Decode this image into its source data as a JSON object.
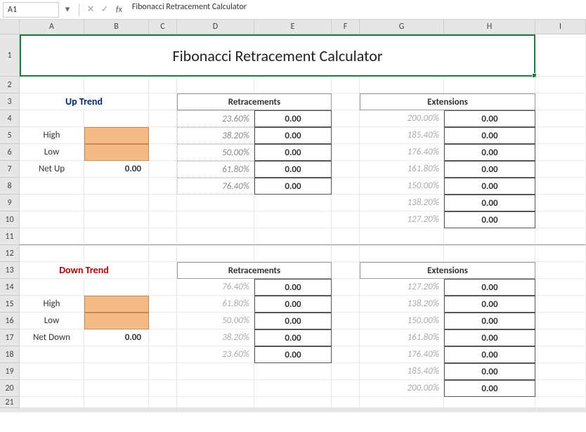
{
  "namebox": "A1",
  "fx_label": "fx",
  "formula": "Fibonacci Retracement Calculator",
  "columns": [
    "",
    "A",
    "B",
    "C",
    "D",
    "E",
    "F",
    "G",
    "H",
    "I"
  ],
  "title": "Fibonacci Retracement Calculator",
  "up": {
    "heading": "Up Trend",
    "labels": {
      "high": "High",
      "low": "Low",
      "net": "Net Up",
      "net_val": "0.00"
    },
    "retr_hdr": "Retracements",
    "ext_hdr": "Extensions",
    "retr": [
      {
        "pct": "23.60%",
        "val": "0.00"
      },
      {
        "pct": "38.20%",
        "val": "0.00"
      },
      {
        "pct": "50.00%",
        "val": "0.00"
      },
      {
        "pct": "61.80%",
        "val": "0.00"
      },
      {
        "pct": "76.40%",
        "val": "0.00"
      }
    ],
    "ext": [
      {
        "pct": "200.00%",
        "val": "0.00"
      },
      {
        "pct": "185.40%",
        "val": "0.00"
      },
      {
        "pct": "176.40%",
        "val": "0.00"
      },
      {
        "pct": "161.80%",
        "val": "0.00"
      },
      {
        "pct": "150.00%",
        "val": "0.00"
      },
      {
        "pct": "138.20%",
        "val": "0.00"
      },
      {
        "pct": "127.20%",
        "val": "0.00"
      }
    ]
  },
  "down": {
    "heading": "Down Trend",
    "labels": {
      "high": "High",
      "low": "Low",
      "net": "Net Down",
      "net_val": "0.00"
    },
    "retr_hdr": "Retracements",
    "ext_hdr": "Extensions",
    "retr": [
      {
        "pct": "76.40%",
        "val": "0.00"
      },
      {
        "pct": "61.80%",
        "val": "0.00"
      },
      {
        "pct": "50.00%",
        "val": "0.00"
      },
      {
        "pct": "38.20%",
        "val": "0.00"
      },
      {
        "pct": "23.60%",
        "val": "0.00"
      }
    ],
    "ext": [
      {
        "pct": "127.20%",
        "val": "0.00"
      },
      {
        "pct": "138.20%",
        "val": "0.00"
      },
      {
        "pct": "150.00%",
        "val": "0.00"
      },
      {
        "pct": "161.80%",
        "val": "0.00"
      },
      {
        "pct": "176.40%",
        "val": "0.00"
      },
      {
        "pct": "185.40%",
        "val": "0.00"
      },
      {
        "pct": "200.00%",
        "val": "0.00"
      }
    ]
  },
  "chart_data": {
    "type": "table",
    "title": "Fibonacci Retracement Calculator",
    "sections": [
      {
        "name": "Up Trend",
        "inputs": {
          "high": null,
          "low": null,
          "net_up": 0.0
        },
        "retracements": [
          {
            "level_pct": 23.6,
            "value": 0.0
          },
          {
            "level_pct": 38.2,
            "value": 0.0
          },
          {
            "level_pct": 50.0,
            "value": 0.0
          },
          {
            "level_pct": 61.8,
            "value": 0.0
          },
          {
            "level_pct": 76.4,
            "value": 0.0
          }
        ],
        "extensions": [
          {
            "level_pct": 200.0,
            "value": 0.0
          },
          {
            "level_pct": 185.4,
            "value": 0.0
          },
          {
            "level_pct": 176.4,
            "value": 0.0
          },
          {
            "level_pct": 161.8,
            "value": 0.0
          },
          {
            "level_pct": 150.0,
            "value": 0.0
          },
          {
            "level_pct": 138.2,
            "value": 0.0
          },
          {
            "level_pct": 127.2,
            "value": 0.0
          }
        ]
      },
      {
        "name": "Down Trend",
        "inputs": {
          "high": null,
          "low": null,
          "net_down": 0.0
        },
        "retracements": [
          {
            "level_pct": 76.4,
            "value": 0.0
          },
          {
            "level_pct": 61.8,
            "value": 0.0
          },
          {
            "level_pct": 50.0,
            "value": 0.0
          },
          {
            "level_pct": 38.2,
            "value": 0.0
          },
          {
            "level_pct": 23.6,
            "value": 0.0
          }
        ],
        "extensions": [
          {
            "level_pct": 127.2,
            "value": 0.0
          },
          {
            "level_pct": 138.2,
            "value": 0.0
          },
          {
            "level_pct": 150.0,
            "value": 0.0
          },
          {
            "level_pct": 161.8,
            "value": 0.0
          },
          {
            "level_pct": 176.4,
            "value": 0.0
          },
          {
            "level_pct": 185.4,
            "value": 0.0
          },
          {
            "level_pct": 200.0,
            "value": 0.0
          }
        ]
      }
    ]
  }
}
